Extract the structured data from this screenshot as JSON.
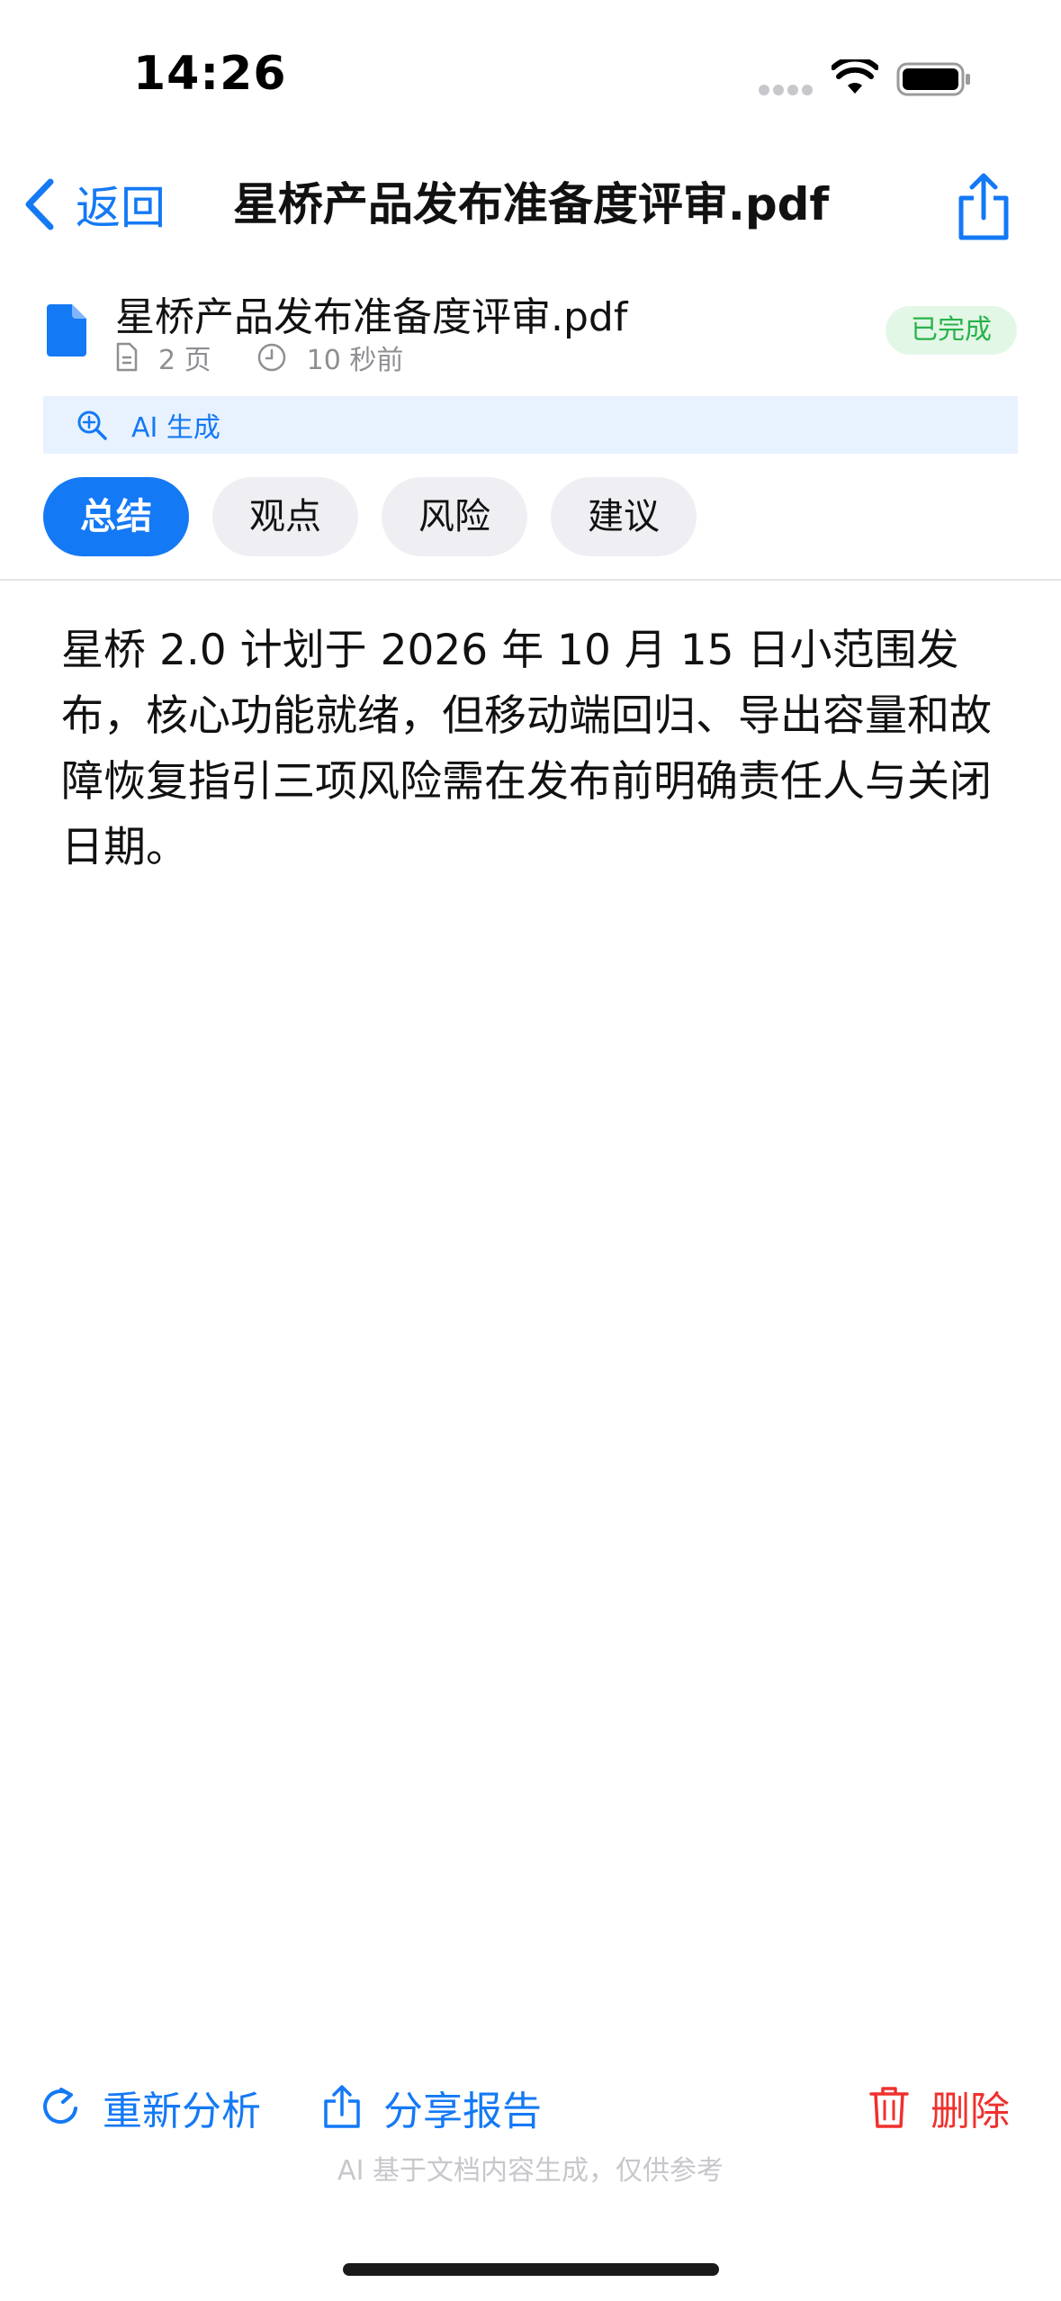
{
  "status_bar": {
    "time": "14:26"
  },
  "nav": {
    "back_label": "返回",
    "title": "星桥产品发布准备度评审.pdf",
    "share_icon": "share-icon"
  },
  "file": {
    "name": "星桥产品发布准备度评审.pdf",
    "pages": "2 页",
    "time_ago": "10 秒前",
    "status": "已完成"
  },
  "ai_banner": {
    "label": "AI 生成",
    "icon": "magnify-sparkle-icon"
  },
  "tabs": [
    {
      "label": "总结",
      "active": true
    },
    {
      "label": "观点",
      "active": false
    },
    {
      "label": "风险",
      "active": false
    },
    {
      "label": "建议",
      "active": false
    }
  ],
  "content": {
    "summary": "星桥 2.0 计划于 2026 年 10 月 15 日小范围发布，核心功能就绪，但移动端回归、导出容量和故障恢复指引三项风险需在发布前明确责任人与关闭日期。"
  },
  "toolbar": {
    "reanalyze_label": "重新分析",
    "share_report_label": "分享报告",
    "delete_label": "删除"
  },
  "footer": {
    "note": "AI 基于文档内容生成，仅供参考"
  },
  "colors": {
    "accent": "#1479f5",
    "success": "#29b24a",
    "danger": "#f0302d",
    "banner_bg": "#e8f2ff"
  }
}
